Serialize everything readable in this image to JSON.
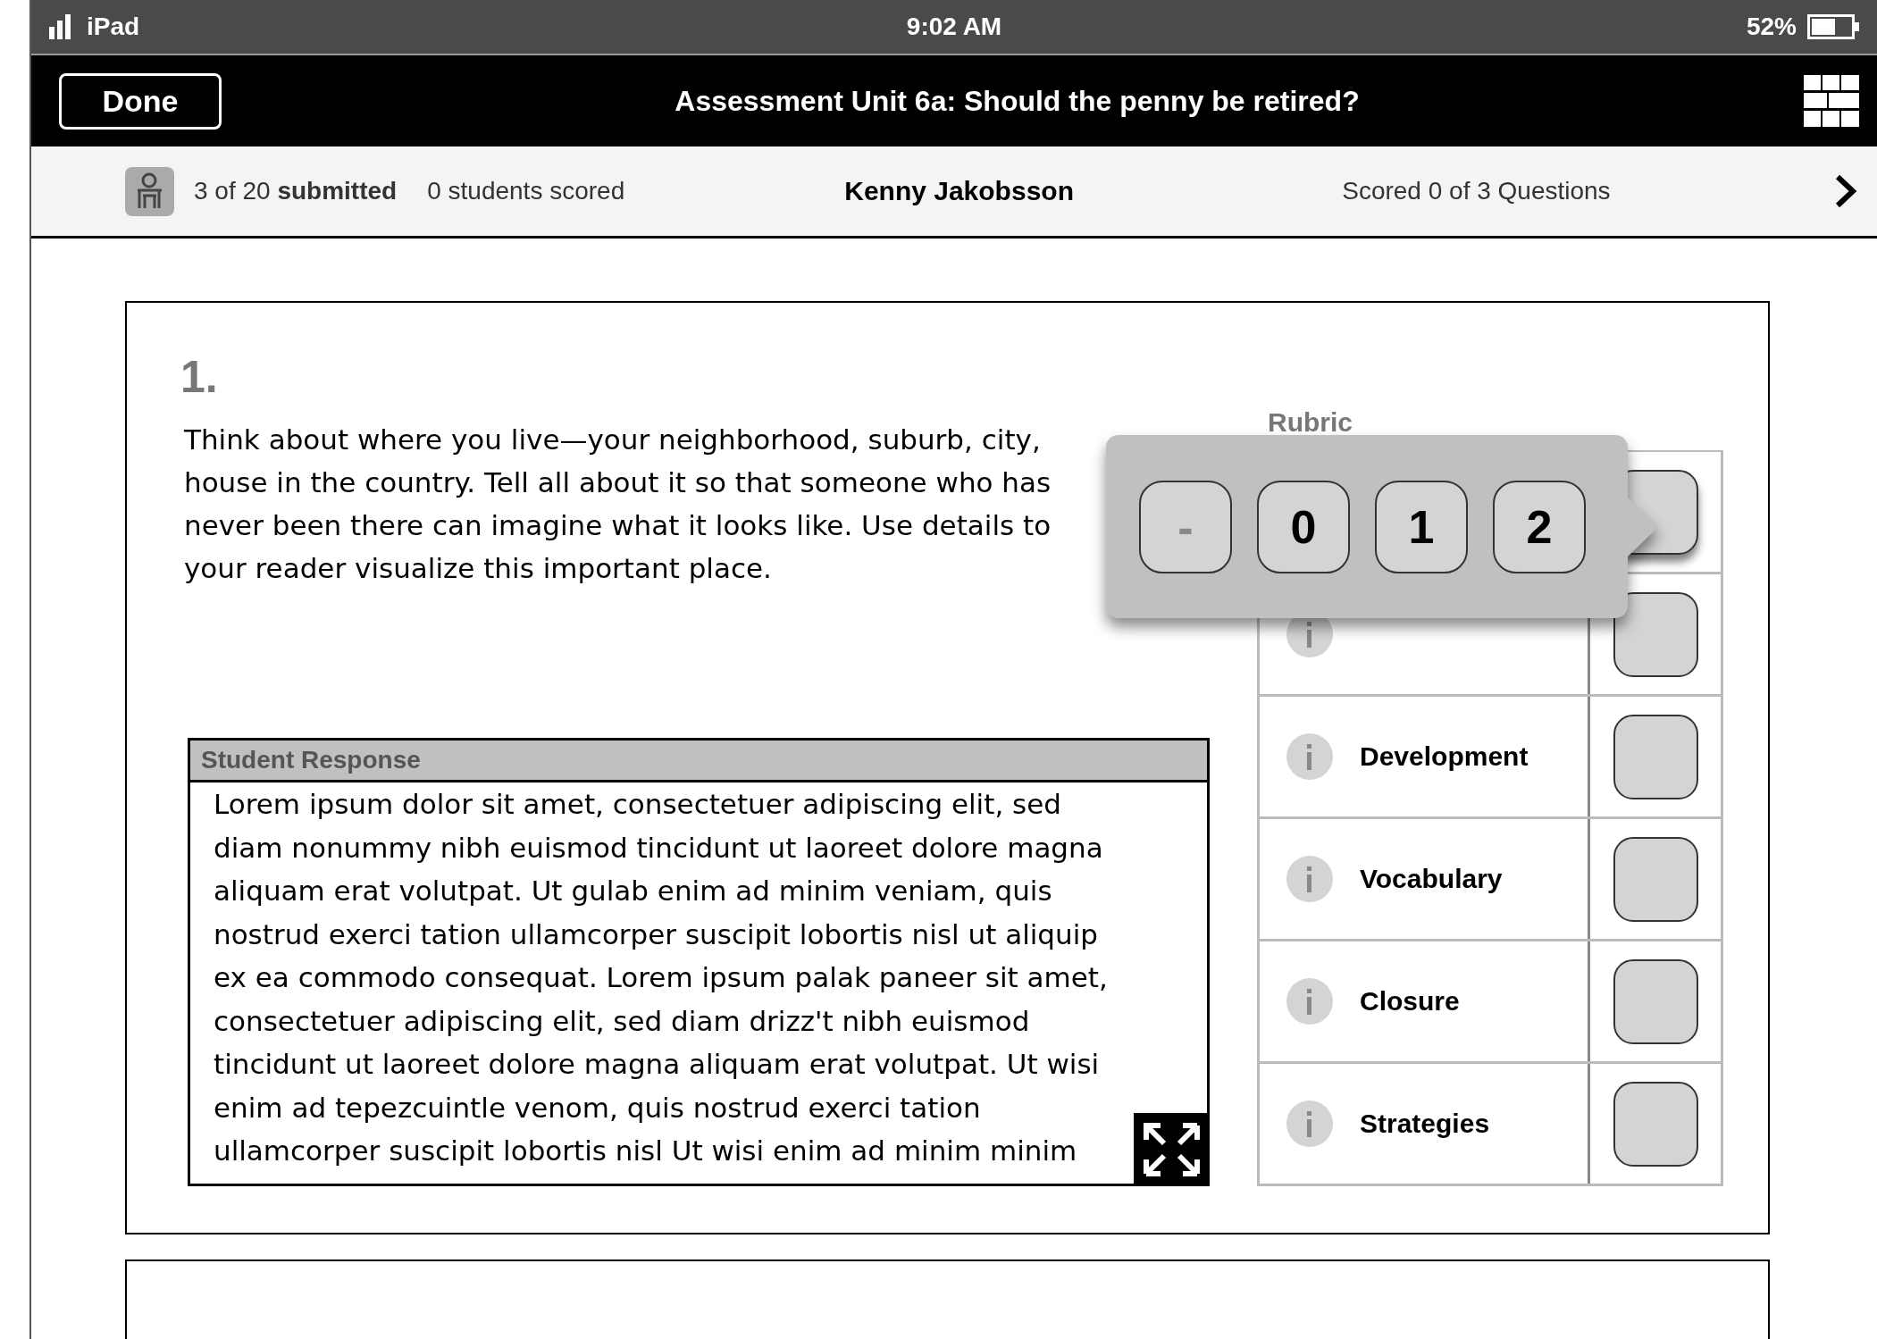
{
  "status_bar": {
    "carrier": "iPad",
    "time": "9:02 AM",
    "battery": "52%"
  },
  "nav_bar": {
    "done_button": "Done",
    "title": "Assessment Unit 6a: Should the penny be retired?"
  },
  "summary_bar": {
    "submitted": "3 of 20 **submitted**",
    "students_scored": "0 students scored",
    "student_name": "Kenny Jakobsson",
    "progress": "Scored 0 of 3 Questions"
  },
  "question": {
    "number": "1.",
    "prompt_lines": [
      "Think about where you live—your neighborhood, suburb, city,",
      "house in the country. Tell all about it so that someone who has",
      "never been there can imagine what it looks like. Use details to",
      "your reader visualize this important place."
    ],
    "response": {
      "heading": "Student Response",
      "text": "Lorem ipsum dolor sit amet, consectetuer adipiscing elit, sed diam nonummy nibh euismod tincidunt ut laoreet dolore magna aliquam erat volutpat. Ut gulab enim ad minim veniam, quis nostrud exerci tation ullamcorper suscipit lobortis nisl ut aliquip ex ea commodo consequat. Lorem ipsum palak paneer sit amet, consectetuer adipiscing elit, sed diam drizz't nibh euismod tincidunt ut laoreet dolore magna aliquam erat volutpat. Ut wisi enim ad tepezcuintle venom, quis nostrud exerci tation ullamcorper suscipit lobortis nisl Ut wisi enim ad minim minim"
    }
  },
  "rubric": {
    "title": "Rubric",
    "criteria": [
      {
        "label": "Development"
      },
      {
        "label": "Vocabulary"
      },
      {
        "label": "Closure"
      },
      {
        "label": "Strategies"
      }
    ]
  },
  "score_popover": {
    "options": [
      {
        "label": "-",
        "kind": "clear"
      },
      {
        "label": "0",
        "kind": "score"
      },
      {
        "label": "1",
        "kind": "score"
      },
      {
        "label": "2",
        "kind": "score"
      }
    ]
  }
}
